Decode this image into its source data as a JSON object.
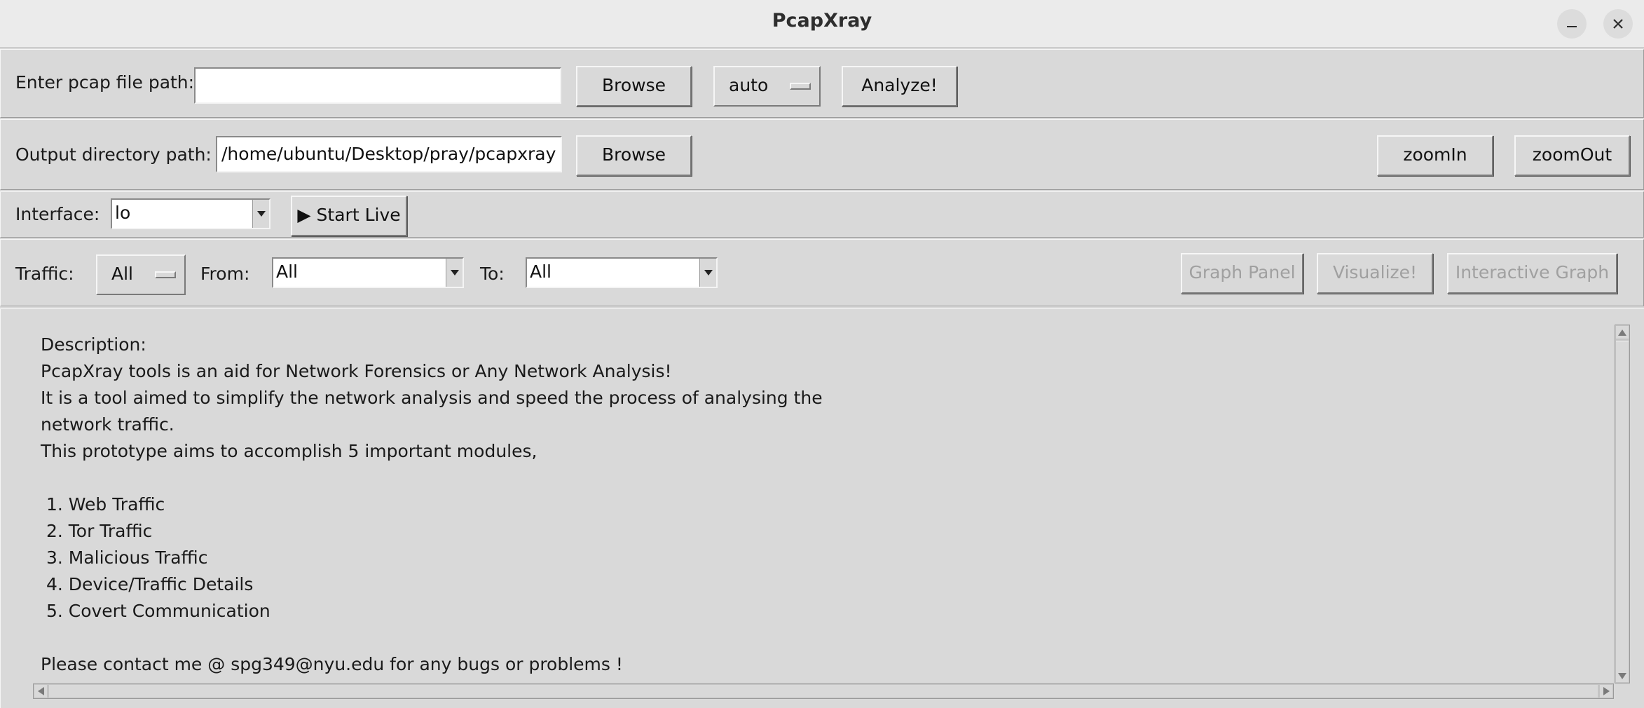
{
  "window": {
    "title": "PcapXray",
    "minimize_icon": "minimize-icon",
    "close_icon": "close-icon"
  },
  "row1": {
    "pcap_label": "Enter pcap file path:",
    "pcap_value": "",
    "browse_label": "Browse",
    "engine_value": "auto",
    "analyze_label": "Analyze!"
  },
  "row2": {
    "output_label": "Output directory path:",
    "output_value": "/home/ubuntu/Desktop/pray/pcapxray",
    "browse_label": "Browse",
    "zoomin_label": "zoomIn",
    "zoomout_label": "zoomOut"
  },
  "row3": {
    "interface_label": "Interface:",
    "interface_value": "lo",
    "start_live_label": "▶ Start Live"
  },
  "row4": {
    "traffic_label": "Traffic:",
    "traffic_value": "All",
    "from_label": "From:",
    "from_value": "All",
    "to_label": "To:",
    "to_value": "All",
    "graph_panel_label": "Graph Panel",
    "visualize_label": "Visualize!",
    "interactive_graph_label": "Interactive Graph"
  },
  "description": {
    "lines": [
      "Description:",
      "PcapXray tools is an aid for Network Forensics or Any Network Analysis!",
      "It is a tool aimed to simplify the network analysis and speed the process of analysing the",
      "network traffic.",
      "This prototype aims to accomplish 5 important modules,",
      "",
      " 1. Web Traffic",
      " 2. Tor Traffic",
      " 3. Malicious Traffic",
      " 4. Device/Traffic Details",
      " 5. Covert Communication",
      "",
      "Please contact me @ spg349@nyu.edu for any bugs or problems !"
    ]
  }
}
